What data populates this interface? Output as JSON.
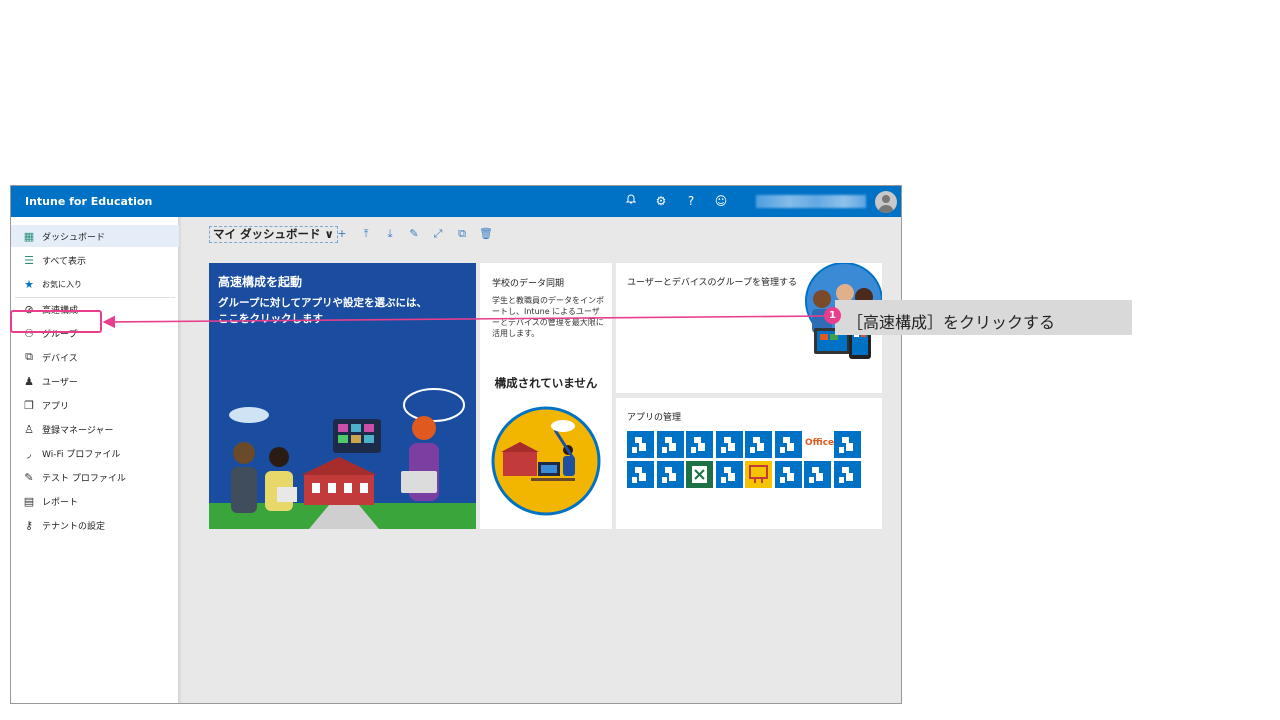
{
  "app": {
    "title": "Intune for Education",
    "topbar_icons": [
      "bell-icon",
      "gear-icon",
      "help-icon",
      "smiley-icon"
    ],
    "brand_color": "#0072c6"
  },
  "sidebar": {
    "collapse_glyph": "«",
    "items": [
      {
        "label": "ダッシュボード",
        "icon": "dashboard-icon",
        "glyph": "▦"
      },
      {
        "label": "すべて表示",
        "icon": "list-icon",
        "glyph": "☰"
      },
      {
        "label": "お気に入り",
        "icon": "star-icon",
        "glyph": "★"
      },
      {
        "label": "高速構成",
        "icon": "quick-config-icon",
        "glyph": "⊘"
      },
      {
        "label": "グループ",
        "icon": "group-icon",
        "glyph": "⚇"
      },
      {
        "label": "デバイス",
        "icon": "device-icon",
        "glyph": "⧉"
      },
      {
        "label": "ユーザー",
        "icon": "user-icon",
        "glyph": "♟"
      },
      {
        "label": "アプリ",
        "icon": "app-icon",
        "glyph": "❐"
      },
      {
        "label": "登録マネージャー",
        "icon": "enrollment-manager-icon",
        "glyph": "♙"
      },
      {
        "label": "Wi-Fi プロファイル",
        "icon": "wifi-icon",
        "glyph": "◞"
      },
      {
        "label": "テスト プロファイル",
        "icon": "pen-icon",
        "glyph": "✎"
      },
      {
        "label": "レポート",
        "icon": "report-icon",
        "glyph": "▤"
      },
      {
        "label": "テナントの設定",
        "icon": "key-icon",
        "glyph": "⚷"
      }
    ]
  },
  "toolbar": {
    "dashboard_name": "マイ ダッシュボード ∨",
    "tools": [
      {
        "icon": "add-icon",
        "glyph": "+"
      },
      {
        "icon": "upload-icon",
        "glyph": "⤒"
      },
      {
        "icon": "download-icon",
        "glyph": "⤓"
      },
      {
        "icon": "edit-icon",
        "glyph": "✎"
      },
      {
        "icon": "fullscreen-icon",
        "glyph": "⤢"
      },
      {
        "icon": "copy-icon",
        "glyph": "⧉"
      },
      {
        "icon": "delete-icon",
        "glyph": "🗑"
      }
    ]
  },
  "tiles": {
    "quick": {
      "title": "高速構成を起動",
      "desc": "グループに対してアプリや設定を選ぶには、ここをクリックします"
    },
    "sync": {
      "title": "学校のデータ同期",
      "desc": "学生と教職員のデータをインポートし、Intune によるユーザーとデバイスの管理を最大限に活用します。",
      "status": "構成されていません"
    },
    "groups": {
      "title": "ユーザーとデバイスのグループを管理する"
    },
    "apps": {
      "title": "アプリの管理",
      "office_label": "Office",
      "icons": [
        "generic",
        "generic",
        "generic",
        "generic",
        "generic",
        "generic",
        "office",
        "generic",
        "generic",
        "generic",
        "excel",
        "generic",
        "ppt",
        "generic",
        "generic",
        "generic"
      ]
    }
  },
  "annotation": {
    "number": "1",
    "text": "［高速構成］をクリックする",
    "color": "#e83e8c"
  }
}
